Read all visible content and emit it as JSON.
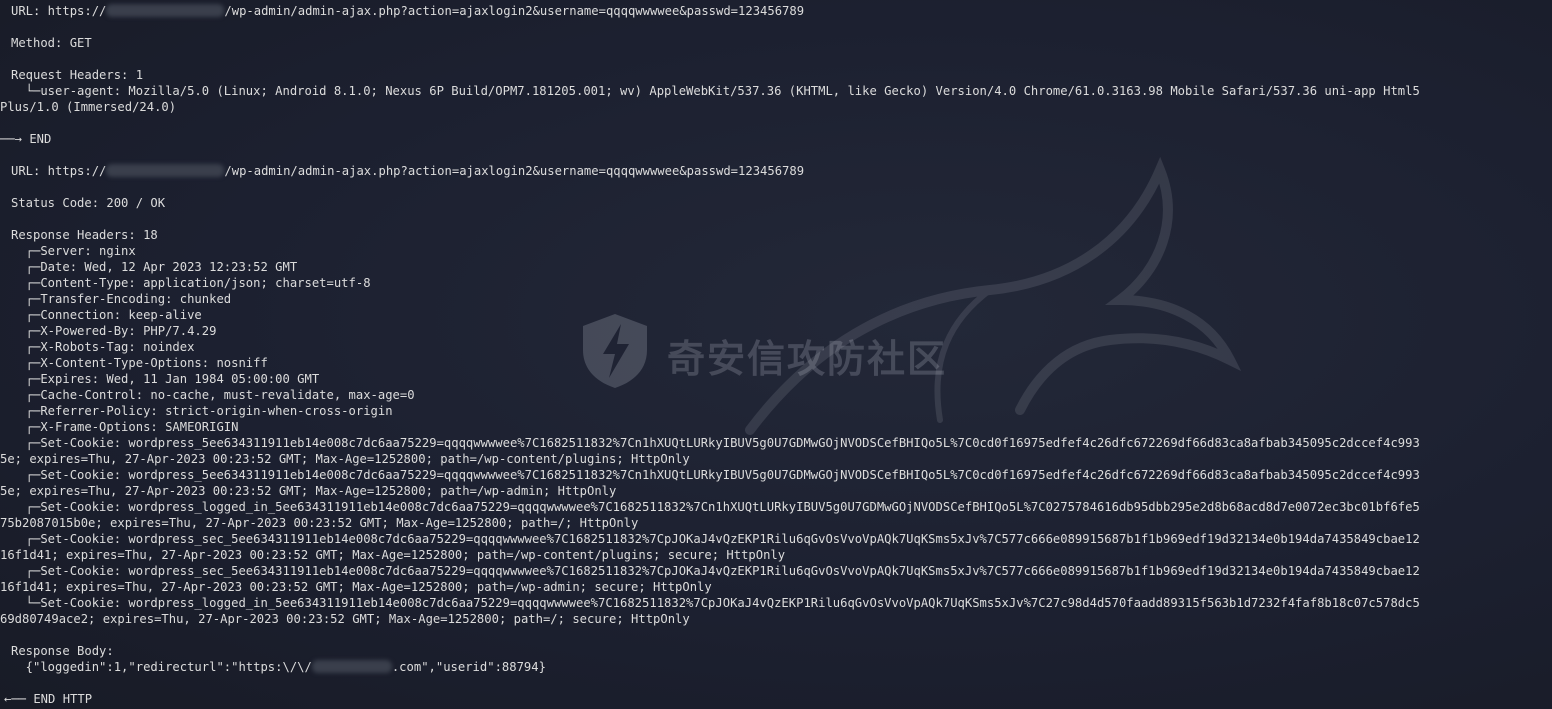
{
  "request": {
    "url_prefix": "URL: https://",
    "url_suffix": "/wp-admin/admin-ajax.php?action=ajaxlogin2&username=qqqqwwwwee&passwd=123456789",
    "method": "Method: GET",
    "headers_label": "Request Headers: 1",
    "user_agent_line1": "  └─user-agent: Mozilla/5.0 (Linux; Android 8.1.0; Nexus 6P Build/OPM7.181205.001; wv) AppleWebKit/537.36 (KHTML, like Gecko) Version/4.0 Chrome/61.0.3163.98 Mobile Safari/537.36 uni-app Html5",
    "user_agent_line2": "Plus/1.0 (Immersed/24.0)",
    "end": "──→ END"
  },
  "response": {
    "url_prefix": "URL: https://",
    "url_suffix": "/wp-admin/admin-ajax.php?action=ajaxlogin2&username=qqqqwwwwee&passwd=123456789",
    "status": "Status Code: 200 / OK",
    "headers_label": "Response Headers: 18",
    "headers": [
      "  ┌─Server: nginx",
      "  ┌─Date: Wed, 12 Apr 2023 12:23:52 GMT",
      "  ┌─Content-Type: application/json; charset=utf-8",
      "  ┌─Transfer-Encoding: chunked",
      "  ┌─Connection: keep-alive",
      "  ┌─X-Powered-By: PHP/7.4.29",
      "  ┌─X-Robots-Tag: noindex",
      "  ┌─X-Content-Type-Options: nosniff",
      "  ┌─Expires: Wed, 11 Jan 1984 05:00:00 GMT",
      "  ┌─Cache-Control: no-cache, must-revalidate, max-age=0",
      "  ┌─Referrer-Policy: strict-origin-when-cross-origin",
      "  ┌─X-Frame-Options: SAMEORIGIN",
      "  ┌─Set-Cookie: wordpress_5ee634311911eb14e008c7dc6aa75229=qqqqwwwwee%7C1682511832%7Cn1hXUQtLURkyIBUV5g0U7GDMwGOjNVODSCefBHIQo5L%7C0cd0f16975edfef4c26dfc672269df66d83ca8afbab345095c2dccef4c993",
      "5e; expires=Thu, 27-Apr-2023 00:23:52 GMT; Max-Age=1252800; path=/wp-content/plugins; HttpOnly",
      "  ┌─Set-Cookie: wordpress_5ee634311911eb14e008c7dc6aa75229=qqqqwwwwee%7C1682511832%7Cn1hXUQtLURkyIBUV5g0U7GDMwGOjNVODSCefBHIQo5L%7C0cd0f16975edfef4c26dfc672269df66d83ca8afbab345095c2dccef4c993",
      "5e; expires=Thu, 27-Apr-2023 00:23:52 GMT; Max-Age=1252800; path=/wp-admin; HttpOnly",
      "  ┌─Set-Cookie: wordpress_logged_in_5ee634311911eb14e008c7dc6aa75229=qqqqwwwwee%7C1682511832%7Cn1hXUQtLURkyIBUV5g0U7GDMwGOjNVODSCefBHIQo5L%7C0275784616db95dbb295e2d8b68acd8d7e0072ec3bc01bf6fe5",
      "75b2087015b0e; expires=Thu, 27-Apr-2023 00:23:52 GMT; Max-Age=1252800; path=/; HttpOnly",
      "  ┌─Set-Cookie: wordpress_sec_5ee634311911eb14e008c7dc6aa75229=qqqqwwwwee%7C1682511832%7CpJOKaJ4vQzEKP1Rilu6qGvOsVvoVpAQk7UqKSms5xJv%7C577c666e089915687b1f1b969edf19d32134e0b194da7435849cbae12",
      "16f1d41; expires=Thu, 27-Apr-2023 00:23:52 GMT; Max-Age=1252800; path=/wp-content/plugins; secure; HttpOnly",
      "  ┌─Set-Cookie: wordpress_sec_5ee634311911eb14e008c7dc6aa75229=qqqqwwwwee%7C1682511832%7CpJOKaJ4vQzEKP1Rilu6qGvOsVvoVpAQk7UqKSms5xJv%7C577c666e089915687b1f1b969edf19d32134e0b194da7435849cbae12",
      "16f1d41; expires=Thu, 27-Apr-2023 00:23:52 GMT; Max-Age=1252800; path=/wp-admin; secure; HttpOnly",
      "  └─Set-Cookie: wordpress_logged_in_5ee634311911eb14e008c7dc6aa75229=qqqqwwwwee%7C1682511832%7CpJOKaJ4vQzEKP1Rilu6qGvOsVvoVpAQk7UqKSms5xJv%7C27c98d4d570faadd89315f563b1d7232f4faf8b18c07c578dc5",
      "69d80749ace2; expires=Thu, 27-Apr-2023 00:23:52 GMT; Max-Age=1252800; path=/; secure; HttpOnly"
    ],
    "body_label": "Response Body:",
    "body_prefix": "  {\"loggedin\":1,\"redirecturl\":\"https:\\/\\/",
    "body_suffix": ".com\",\"userid\":88794}",
    "end": "←── END HTTP"
  },
  "watermark": {
    "text": "奇安信攻防社区",
    "icon": "shield-lightning-icon"
  },
  "colors": {
    "background": "#1b1e29",
    "text": "#dcdcdc",
    "redaction": "#3a3f4c"
  }
}
